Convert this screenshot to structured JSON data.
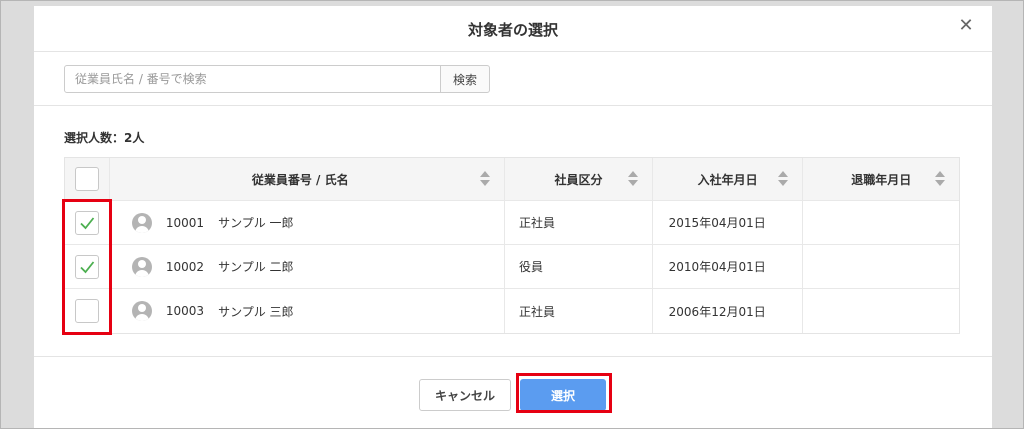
{
  "dialog": {
    "title": "対象者の選択",
    "close_symbol": "✕"
  },
  "search": {
    "placeholder": "従業員氏名 / 番号で検索",
    "button_label": "検索"
  },
  "selection_count": "選択人数：2人",
  "table": {
    "headers": {
      "name": "従業員番号 / 氏名",
      "type": "社員区分",
      "join": "入社年月日",
      "retire": "退職年月日"
    },
    "rows": [
      {
        "id": "10001",
        "name": "サンプル 一郎",
        "type": "正社員",
        "join_date": "2015年04月01日",
        "retire_date": "",
        "checked": true
      },
      {
        "id": "10002",
        "name": "サンプル 二郎",
        "type": "役員",
        "join_date": "2010年04月01日",
        "retire_date": "",
        "checked": true
      },
      {
        "id": "10003",
        "name": "サンプル 三郎",
        "type": "正社員",
        "join_date": "2006年12月01日",
        "retire_date": "",
        "checked": false
      }
    ]
  },
  "footer": {
    "cancel_label": "キャンセル",
    "select_label": "選択"
  },
  "colors": {
    "primary_button": "#5b9cf0",
    "check_mark": "#4caf50",
    "highlight_border": "#e60012"
  }
}
